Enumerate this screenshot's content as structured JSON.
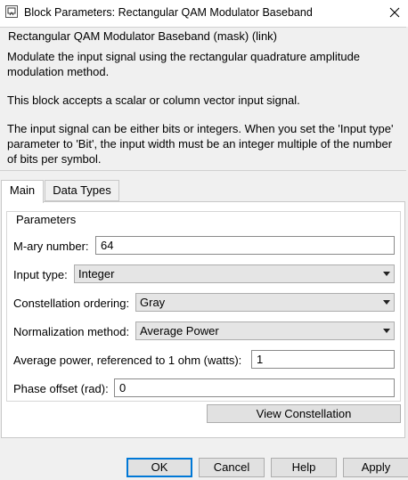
{
  "window": {
    "title": "Block Parameters: Rectangular QAM Modulator Baseband",
    "close_label": "close"
  },
  "description": {
    "title": "Rectangular QAM Modulator Baseband (mask) (link)",
    "paragraphs": [
      "Modulate the input signal using the rectangular quadrature amplitude modulation method.",
      "This block accepts a scalar or column vector input signal.",
      "The input signal can be either bits or integers. When you set the 'Input type' parameter to 'Bit', the input width must be an integer multiple of the number of bits per symbol."
    ]
  },
  "tabs": [
    {
      "label": "Main",
      "active": true
    },
    {
      "label": "Data Types",
      "active": false
    }
  ],
  "parameters": {
    "legend": "Parameters",
    "mary_label": "M-ary number:",
    "mary_value": "64",
    "input_type_label": "Input type:",
    "input_type_value": "Integer",
    "constellation_label": "Constellation ordering:",
    "constellation_value": "Gray",
    "normalization_label": "Normalization method:",
    "normalization_value": "Average Power",
    "avg_power_label": "Average power, referenced to 1 ohm (watts):",
    "avg_power_value": "1",
    "phase_label": "Phase offset (rad):",
    "phase_value": "0"
  },
  "view_constellation_label": "View Constellation",
  "buttons": {
    "ok": "OK",
    "cancel": "Cancel",
    "help": "Help",
    "apply": "Apply"
  },
  "colors": {
    "focus_border": "#0078d7",
    "dialog_bg": "#f0f0f0"
  }
}
